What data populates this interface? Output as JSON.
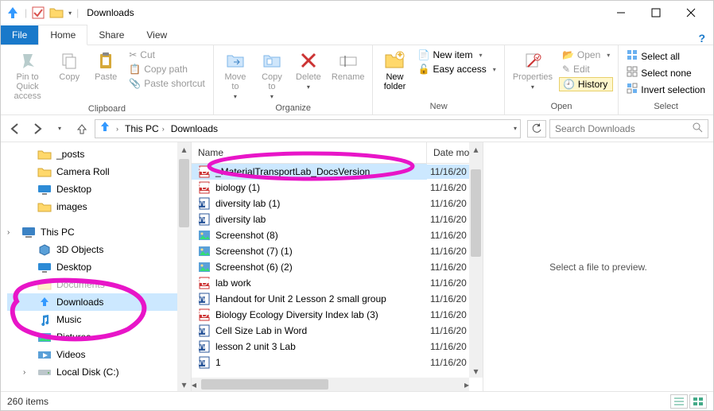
{
  "window": {
    "title": "Downloads",
    "tabs": {
      "file": "File",
      "home": "Home",
      "share": "Share",
      "view": "View"
    }
  },
  "ribbon": {
    "clipboard": {
      "title": "Clipboard",
      "pin": "Pin to Quick\naccess",
      "copy": "Copy",
      "paste": "Paste",
      "cut": "Cut",
      "copy_path": "Copy path",
      "paste_shortcut": "Paste shortcut"
    },
    "organize": {
      "title": "Organize",
      "move_to": "Move\nto",
      "copy_to": "Copy\nto",
      "delete": "Delete",
      "rename": "Rename"
    },
    "new": {
      "title": "New",
      "new_folder": "New\nfolder",
      "new_item": "New item",
      "easy_access": "Easy access"
    },
    "open": {
      "title": "Open",
      "properties": "Properties",
      "open": "Open",
      "edit": "Edit",
      "history": "History"
    },
    "select": {
      "title": "Select",
      "select_all": "Select all",
      "select_none": "Select none",
      "invert": "Invert selection"
    }
  },
  "address": {
    "crumbs": [
      "This PC",
      "Downloads"
    ],
    "search_placeholder": "Search Downloads"
  },
  "tree": {
    "items": [
      {
        "label": "_posts",
        "icon": "folder",
        "indent": 1
      },
      {
        "label": "Camera Roll",
        "icon": "folder",
        "indent": 1
      },
      {
        "label": "Desktop",
        "icon": "desktop",
        "indent": 1
      },
      {
        "label": "images",
        "icon": "folder",
        "indent": 1
      },
      {
        "label": "This PC",
        "icon": "pc",
        "indent": 0,
        "caret": true,
        "spacer": true
      },
      {
        "label": "3D Objects",
        "icon": "3d",
        "indent": 1
      },
      {
        "label": "Desktop",
        "icon": "desktop",
        "indent": 1
      },
      {
        "label": "Documents",
        "icon": "folder",
        "indent": 1,
        "partial": true
      },
      {
        "label": "Downloads",
        "icon": "downloads",
        "indent": 1,
        "selected": true
      },
      {
        "label": "Music",
        "icon": "music",
        "indent": 1
      },
      {
        "label": "Pictures",
        "icon": "pictures",
        "indent": 1
      },
      {
        "label": "Videos",
        "icon": "videos",
        "indent": 1
      },
      {
        "label": "Local Disk (C:)",
        "icon": "disk",
        "indent": 1,
        "caret": true
      }
    ]
  },
  "columns": {
    "name": "Name",
    "date": "Date mod"
  },
  "files": [
    {
      "name": "_MaterialTransportLab_DocsVersion",
      "icon": "pdf",
      "date": "11/16/20",
      "selected": true
    },
    {
      "name": "biology (1)",
      "icon": "pdf",
      "date": "11/16/20"
    },
    {
      "name": "diversity lab  (1)",
      "icon": "word",
      "date": "11/16/20"
    },
    {
      "name": "diversity lab",
      "icon": "word",
      "date": "11/16/20"
    },
    {
      "name": "Screenshot (8)",
      "icon": "img",
      "date": "11/16/20"
    },
    {
      "name": "Screenshot (7) (1)",
      "icon": "img",
      "date": "11/16/20"
    },
    {
      "name": "Screenshot (6) (2)",
      "icon": "img",
      "date": "11/16/20"
    },
    {
      "name": "lab work",
      "icon": "pdf",
      "date": "11/16/20"
    },
    {
      "name": "Handout for Unit 2 Lesson 2 small group",
      "icon": "word",
      "date": "11/16/20"
    },
    {
      "name": "Biology Ecology Diversity Index lab (3)",
      "icon": "pdf",
      "date": "11/16/20"
    },
    {
      "name": "Cell Size Lab in Word",
      "icon": "word",
      "date": "11/16/20"
    },
    {
      "name": "lesson 2 unit 3 Lab",
      "icon": "word",
      "date": "11/16/20"
    },
    {
      "name": "1",
      "icon": "word",
      "date": "11/16/20"
    }
  ],
  "preview": {
    "msg": "Select a file to preview."
  },
  "status": {
    "count": "260 items"
  }
}
